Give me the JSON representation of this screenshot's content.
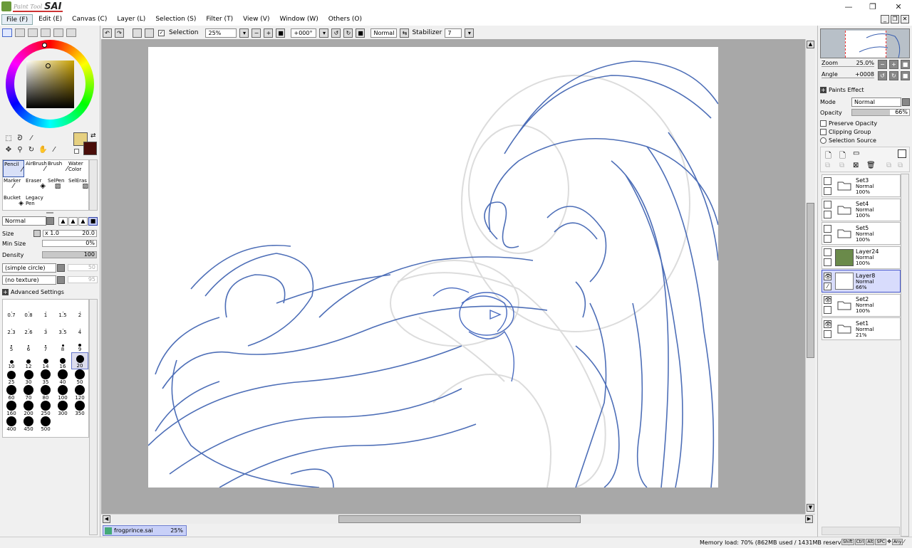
{
  "app": {
    "title_small": "Paint Tool",
    "title_big": "SAI"
  },
  "window": {
    "minimize": "—",
    "restore": "❐",
    "close": "✕"
  },
  "menu": [
    {
      "label": "File (F)",
      "active": true
    },
    {
      "label": "Edit (E)"
    },
    {
      "label": "Canvas (C)"
    },
    {
      "label": "Layer (L)"
    },
    {
      "label": "Selection (S)"
    },
    {
      "label": "Filter (T)"
    },
    {
      "label": "View (V)"
    },
    {
      "label": "Window (W)"
    },
    {
      "label": "Others (O)"
    }
  ],
  "canvas_toolbar": {
    "selection_label": "Selection",
    "zoom": "25%",
    "rotation": "+000°",
    "blend": "Normal",
    "stabilizer_label": "Stabilizer",
    "stabilizer_value": "7"
  },
  "colors": {
    "primary": "#e6d080",
    "secondary": "#4a0e0a",
    "accent_select": "#d8dcfc"
  },
  "tools": [
    {
      "label": "Pencil",
      "selected": true
    },
    {
      "label": "AirBrush"
    },
    {
      "label": "Brush"
    },
    {
      "label": "Water Color"
    },
    {
      "label": "Marker"
    },
    {
      "label": "Eraser"
    },
    {
      "label": "SelPen"
    },
    {
      "label": "SelEras"
    },
    {
      "label": "Bucket"
    },
    {
      "label": "Legacy Pen"
    }
  ],
  "brush": {
    "mode": "Normal",
    "size_label": "Size",
    "size_mult": "x 1.0",
    "size_value": "20.0",
    "minsize_label": "Min Size",
    "minsize_value": "0%",
    "density_label": "Density",
    "density_value": "100",
    "shape": "(simple circle)",
    "shape_value": "50",
    "texture": "(no texture)",
    "texture_value": "95",
    "advanced": "Advanced Settings"
  },
  "brush_sizes": [
    "0.7",
    "0.8",
    "1",
    "1.5",
    "2",
    "2.3",
    "2.6",
    "3",
    "3.5",
    "4",
    "5",
    "6",
    "7",
    "8",
    "9",
    "10",
    "12",
    "14",
    "16",
    "20",
    "25",
    "30",
    "35",
    "40",
    "50",
    "60",
    "70",
    "80",
    "100",
    "120",
    "160",
    "200",
    "250",
    "300",
    "350",
    "400",
    "450",
    "500"
  ],
  "selected_size": "20",
  "document": {
    "name": "frogprince.sai",
    "zoom": "25%"
  },
  "navigator": {
    "zoom_label": "Zoom",
    "zoom_value": "25.0%",
    "angle_label": "Angle",
    "angle_value": "+0008"
  },
  "paints_effect": "Paints Effect",
  "layer_props": {
    "mode_label": "Mode",
    "mode_value": "Normal",
    "opacity_label": "Opacity",
    "opacity_value": "66%",
    "preserve_opacity": "Preserve Opacity",
    "clipping_group": "Clipping Group",
    "selection_source": "Selection Source"
  },
  "layers": [
    {
      "name": "Set3",
      "mode": "Normal",
      "opacity": "100%",
      "type": "folder",
      "visible": false
    },
    {
      "name": "Set4",
      "mode": "Normal",
      "opacity": "100%",
      "type": "folder",
      "visible": false
    },
    {
      "name": "Set5",
      "mode": "Normal",
      "opacity": "100%",
      "type": "folder",
      "visible": false
    },
    {
      "name": "Layer24",
      "mode": "Normal",
      "opacity": "100%",
      "type": "fill",
      "visible": false
    },
    {
      "name": "Layer8",
      "mode": "Normal",
      "opacity": "66%",
      "type": "layer",
      "visible": true,
      "selected": true
    },
    {
      "name": "Set2",
      "mode": "Normal",
      "opacity": "100%",
      "type": "folder",
      "visible": true
    },
    {
      "name": "Set1",
      "mode": "Normal",
      "opacity": "21%",
      "type": "folder",
      "visible": true
    }
  ],
  "status": {
    "memory": "Memory load: 70% (862MB used / 1431MB reserved)",
    "keys": [
      "Shift",
      "Ctrl",
      "Alt",
      "SPC",
      "Any"
    ]
  }
}
